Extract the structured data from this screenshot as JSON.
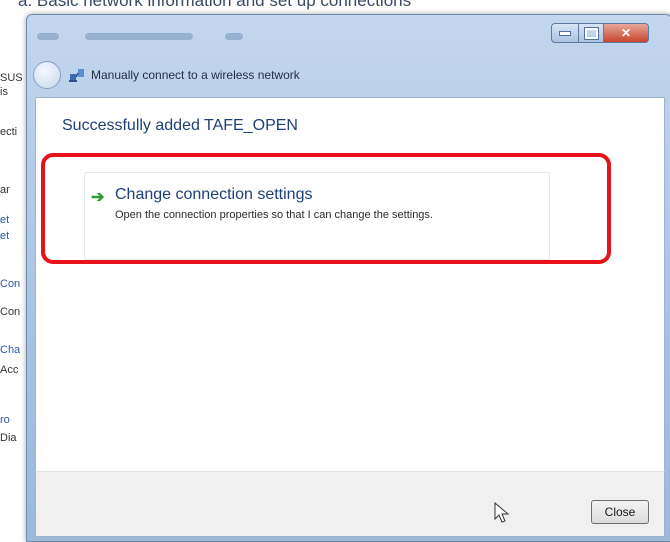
{
  "background": {
    "heading": "a. Basic network information and set up connections",
    "left_fragments": [
      {
        "text": "SUS",
        "link": false
      },
      {
        "text": "is",
        "link": false
      },
      {
        "text": "ecti",
        "link": false
      },
      {
        "text": "ar",
        "link": false
      },
      {
        "text": "et",
        "link": true
      },
      {
        "text": "et",
        "link": true
      },
      {
        "text": "Con",
        "link": true
      },
      {
        "text": "Con",
        "link": false
      },
      {
        "text": "Cha",
        "link": true
      },
      {
        "text": "Acc",
        "link": false
      },
      {
        "text": "ro",
        "link": true
      },
      {
        "text": "Dia",
        "link": false
      }
    ]
  },
  "window": {
    "nav_title": "Manually connect to a wireless network",
    "heading": "Successfully added TAFE_OPEN",
    "task": {
      "title": "Change connection settings",
      "description": "Open the connection properties so that I can change the settings."
    },
    "close_label": "Close",
    "accent": "#1e3f78",
    "highlight_color": "#e8121a"
  },
  "icons": [
    "back-icon",
    "network-icon",
    "arrow-right-icon",
    "minimize-icon",
    "maximize-icon",
    "close-icon",
    "cursor-icon"
  ]
}
